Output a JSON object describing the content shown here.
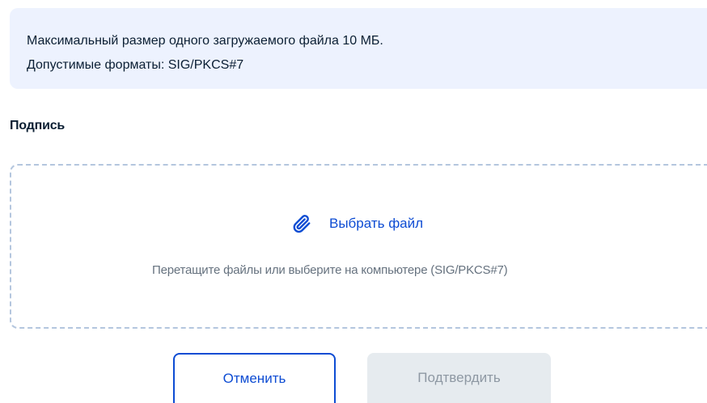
{
  "info": {
    "line1": "Максимальный размер одного загружаемого файла 10 МБ.",
    "line2": "Допустимые форматы: SIG/PKCS#7"
  },
  "signature": {
    "label": "Подпись"
  },
  "dropzone": {
    "action_label": "Выбрать файл",
    "action_icon": "paperclip-icon",
    "hint": "Перетащите файлы или выберите на компьютере (SIG/PKCS#7)"
  },
  "buttons": {
    "cancel_label": "Отменить",
    "confirm_label": "Подтвердить",
    "confirm_disabled": true
  },
  "colors": {
    "accent": "#0d4cd3",
    "info_background": "#edf2fe",
    "dropzone_border": "#b4c6de",
    "disabled_button_bg": "#e6ebef",
    "disabled_button_text": "#8e98a3",
    "hint_text": "#66727f"
  }
}
